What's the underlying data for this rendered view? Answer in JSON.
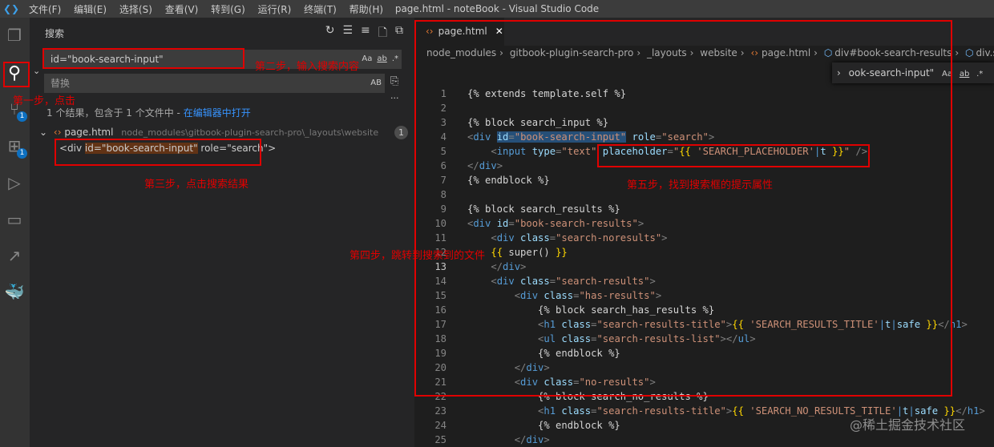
{
  "titlebar": {
    "menu": [
      "文件(F)",
      "编辑(E)",
      "选择(S)",
      "查看(V)",
      "转到(G)",
      "运行(R)",
      "终端(T)",
      "帮助(H)"
    ],
    "title": "page.html - noteBook - Visual Studio Code"
  },
  "activity": {
    "scm_badge": "1",
    "ext_badge": "1"
  },
  "search": {
    "title": "搜索",
    "query": "id=\"book-search-input\"",
    "match_case": "Aa",
    "whole_word": "ab",
    "regex": ".*",
    "replace_placeholder": "替换",
    "preserve_case": "AB",
    "more": "···",
    "summary": "1 个结果，包含于 1 个文件中 - ",
    "open_in_editor": "在编辑器中打开",
    "result_file": "page.html",
    "result_path": "node_modules\\gitbook-plugin-search-pro\\_layouts\\website",
    "result_count": "1",
    "result_pre": "<div ",
    "result_match": "id=\"book-search-input\"",
    "result_post": " role=\"search\">"
  },
  "editor": {
    "tab": "page.html",
    "breadcrumbs": [
      "node_modules",
      "gitbook-plugin-search-pro",
      "_layouts",
      "website",
      "page.html",
      "div#book-search-results",
      "div.search-n"
    ],
    "find_widget": {
      "value": "ook-search-input\"",
      "match_case": "Aa",
      "whole_word": "ab",
      "regex": ".*"
    },
    "current_line": 13,
    "lines": [
      [
        [
          "{% extends template.self %}",
          "txt"
        ]
      ],
      [],
      [
        [
          "{% block search_input %}",
          "txt"
        ]
      ],
      [
        [
          "<",
          "p"
        ],
        [
          "div",
          "tag"
        ],
        [
          " ",
          "txt"
        ],
        [
          "id",
          "attr sel"
        ],
        [
          "=",
          "p sel"
        ],
        [
          "\"book-search-input\"",
          "str sel"
        ],
        [
          " ",
          "txt"
        ],
        [
          "role",
          "attr"
        ],
        [
          "=",
          "p"
        ],
        [
          "\"search\"",
          "str"
        ],
        [
          ">",
          "p"
        ]
      ],
      [
        [
          "    <",
          "p"
        ],
        [
          "input",
          "tag"
        ],
        [
          " ",
          "txt"
        ],
        [
          "type",
          "attr"
        ],
        [
          "=",
          "p"
        ],
        [
          "\"text\"",
          "str"
        ],
        [
          " ",
          "txt"
        ],
        [
          "placeholder",
          "attr"
        ],
        [
          "=",
          "p"
        ],
        [
          "\"",
          "str"
        ],
        [
          "{{",
          "br"
        ],
        [
          " 'SEARCH_PLACEHOLDER'",
          "str"
        ],
        [
          "|",
          "tag"
        ],
        [
          "t ",
          "attr"
        ],
        [
          "}}",
          "br"
        ],
        [
          "\"",
          "str"
        ],
        [
          " />",
          "p"
        ]
      ],
      [
        [
          "</",
          "p"
        ],
        [
          "div",
          "tag"
        ],
        [
          ">",
          "p"
        ]
      ],
      [
        [
          "{% endblock %}",
          "txt"
        ]
      ],
      [],
      [
        [
          "{% block search_results %}",
          "txt"
        ]
      ],
      [
        [
          "<",
          "p"
        ],
        [
          "div",
          "tag"
        ],
        [
          " ",
          "txt"
        ],
        [
          "id",
          "attr"
        ],
        [
          "=",
          "p"
        ],
        [
          "\"book-search-results\"",
          "str"
        ],
        [
          ">",
          "p"
        ]
      ],
      [
        [
          "    <",
          "p"
        ],
        [
          "div",
          "tag"
        ],
        [
          " ",
          "txt"
        ],
        [
          "class",
          "attr"
        ],
        [
          "=",
          "p"
        ],
        [
          "\"search-noresults\"",
          "str"
        ],
        [
          ">",
          "p"
        ]
      ],
      [
        [
          "    ",
          "txt"
        ],
        [
          "{{",
          "br"
        ],
        [
          " super() ",
          "txt"
        ],
        [
          "}}",
          "br"
        ]
      ],
      [
        [
          "    </",
          "p"
        ],
        [
          "div",
          "tag"
        ],
        [
          ">",
          "p"
        ]
      ],
      [
        [
          "    <",
          "p"
        ],
        [
          "div",
          "tag"
        ],
        [
          " ",
          "txt"
        ],
        [
          "class",
          "attr"
        ],
        [
          "=",
          "p"
        ],
        [
          "\"search-results\"",
          "str"
        ],
        [
          ">",
          "p"
        ]
      ],
      [
        [
          "        <",
          "p"
        ],
        [
          "div",
          "tag"
        ],
        [
          " ",
          "txt"
        ],
        [
          "class",
          "attr"
        ],
        [
          "=",
          "p"
        ],
        [
          "\"has-results\"",
          "str"
        ],
        [
          ">",
          "p"
        ]
      ],
      [
        [
          "            {% block search_has_results %}",
          "txt"
        ]
      ],
      [
        [
          "            <",
          "p"
        ],
        [
          "h1",
          "tag"
        ],
        [
          " ",
          "txt"
        ],
        [
          "class",
          "attr"
        ],
        [
          "=",
          "p"
        ],
        [
          "\"search-results-title\"",
          "str"
        ],
        [
          ">",
          "p"
        ],
        [
          "{{",
          "br"
        ],
        [
          " 'SEARCH_RESULTS_TITLE'",
          "str"
        ],
        [
          "|",
          "tag"
        ],
        [
          "t",
          "attr"
        ],
        [
          "|",
          "tag"
        ],
        [
          "safe ",
          "attr"
        ],
        [
          "}}",
          "br"
        ],
        [
          "</",
          "p"
        ],
        [
          "h1",
          "tag"
        ],
        [
          ">",
          "p"
        ]
      ],
      [
        [
          "            <",
          "p"
        ],
        [
          "ul",
          "tag"
        ],
        [
          " ",
          "txt"
        ],
        [
          "class",
          "attr"
        ],
        [
          "=",
          "p"
        ],
        [
          "\"search-results-list\"",
          "str"
        ],
        [
          "></",
          "p"
        ],
        [
          "ul",
          "tag"
        ],
        [
          ">",
          "p"
        ]
      ],
      [
        [
          "            {% endblock %}",
          "txt"
        ]
      ],
      [
        [
          "        </",
          "p"
        ],
        [
          "div",
          "tag"
        ],
        [
          ">",
          "p"
        ]
      ],
      [
        [
          "        <",
          "p"
        ],
        [
          "div",
          "tag"
        ],
        [
          " ",
          "txt"
        ],
        [
          "class",
          "attr"
        ],
        [
          "=",
          "p"
        ],
        [
          "\"no-results\"",
          "str"
        ],
        [
          ">",
          "p"
        ]
      ],
      [
        [
          "            {% block search_no_results %}",
          "txt"
        ]
      ],
      [
        [
          "            <",
          "p"
        ],
        [
          "h1",
          "tag"
        ],
        [
          " ",
          "txt"
        ],
        [
          "class",
          "attr"
        ],
        [
          "=",
          "p"
        ],
        [
          "\"search-results-title\"",
          "str"
        ],
        [
          ">",
          "p"
        ],
        [
          "{{",
          "br"
        ],
        [
          " 'SEARCH_NO_RESULTS_TITLE'",
          "str"
        ],
        [
          "|",
          "tag"
        ],
        [
          "t",
          "attr"
        ],
        [
          "|",
          "tag"
        ],
        [
          "safe ",
          "attr"
        ],
        [
          "}}",
          "br"
        ],
        [
          "</",
          "p"
        ],
        [
          "h1",
          "tag"
        ],
        [
          ">",
          "p"
        ]
      ],
      [
        [
          "            {% endblock %}",
          "txt"
        ]
      ],
      [
        [
          "        </",
          "p"
        ],
        [
          "div",
          "tag"
        ],
        [
          ">",
          "p"
        ]
      ]
    ]
  },
  "annotations": {
    "step1": "第一步，点击",
    "step2": "第二步，输入搜索内容",
    "step3": "第三步，点击搜索结果",
    "step4": "第四步，跳转到搜索到的文件",
    "step5": "第五步，找到搜索框的提示属性",
    "color": "#e00000"
  },
  "watermark": "@稀土掘金技术社区"
}
